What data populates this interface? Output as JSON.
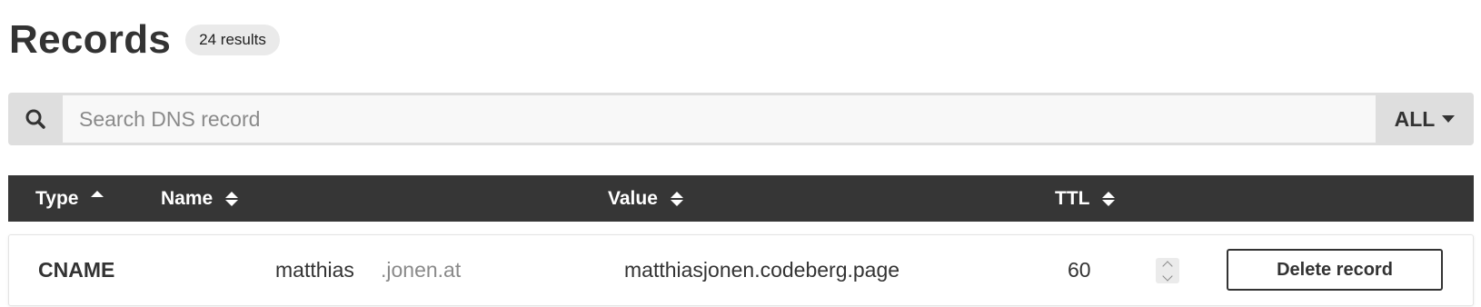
{
  "header": {
    "title": "Records",
    "results_count": "24 results"
  },
  "search": {
    "placeholder": "Search DNS record",
    "value": "",
    "icon": "search-icon",
    "filter_selected": "ALL"
  },
  "table": {
    "columns": [
      {
        "label": "Type",
        "sort": "asc"
      },
      {
        "label": "Name",
        "sort": "none"
      },
      {
        "label": "Value",
        "sort": "none"
      },
      {
        "label": "TTL",
        "sort": "none"
      }
    ],
    "rows": [
      {
        "type": "CNAME",
        "name": "matthias",
        "name_suffix": ".jonen.at",
        "value": "matthiasjonen.codeberg.page",
        "ttl": "60",
        "delete_label": "Delete record"
      }
    ]
  },
  "colors": {
    "header_bg": "#363636",
    "search_bar_bg": "#dedede",
    "badge_bg": "#eaeaea",
    "text": "#333333",
    "muted_text": "#8a8a8a"
  }
}
